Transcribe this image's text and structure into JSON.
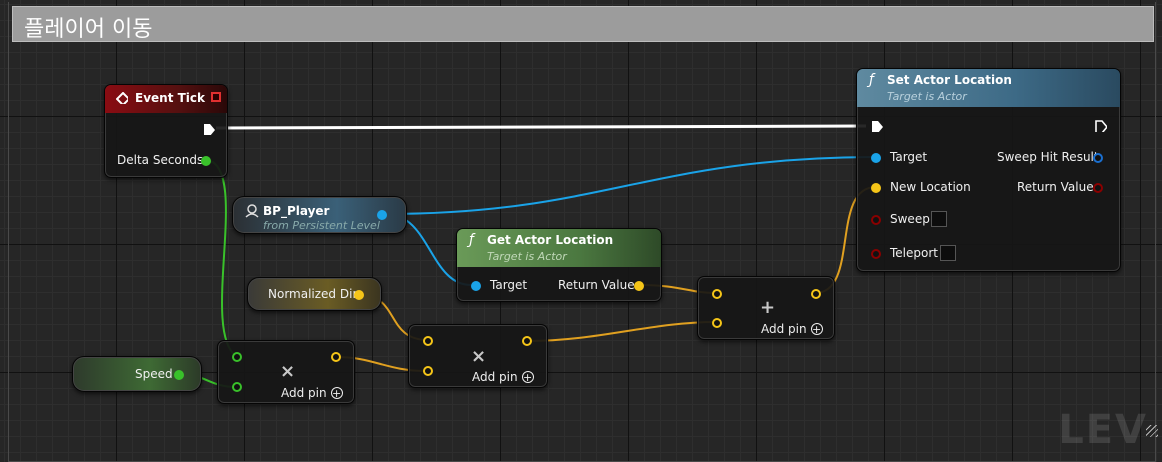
{
  "comment": {
    "title": "플레이어 이동"
  },
  "event_tick": {
    "title": "Event Tick",
    "delta_label": "Delta Seconds"
  },
  "set_actor_location": {
    "title": "Set Actor Location",
    "subtitle": "Target is Actor",
    "target": "Target",
    "new_location": "New Location",
    "sweep": "Sweep",
    "teleport": "Teleport",
    "sweep_hit_result": "Sweep Hit Result",
    "return_value": "Return Value"
  },
  "bp_player": {
    "title": "BP_Player",
    "subtitle": "from Persistent Level"
  },
  "get_actor_location": {
    "title": "Get Actor Location",
    "subtitle": "Target is Actor",
    "target": "Target",
    "return_value": "Return Value"
  },
  "normalized_dir": {
    "label": "Normalized Dir"
  },
  "speed": {
    "label": "Speed"
  },
  "multiply_1": {
    "op": "×",
    "add_pin": "Add pin"
  },
  "multiply_2": {
    "op": "×",
    "add_pin": "Add pin"
  },
  "add_node": {
    "op": "+",
    "add_pin": "Add pin"
  },
  "watermark": "LEV",
  "colors": {
    "exec": "#ffffff",
    "object": "#1aa3e8",
    "vector": "#f5c518",
    "float": "#39c12a",
    "bool": "#8a0000"
  },
  "icons": [
    "event-icon",
    "function-icon",
    "variable-icon",
    "exec-pin-icon",
    "add-pin-icon"
  ]
}
